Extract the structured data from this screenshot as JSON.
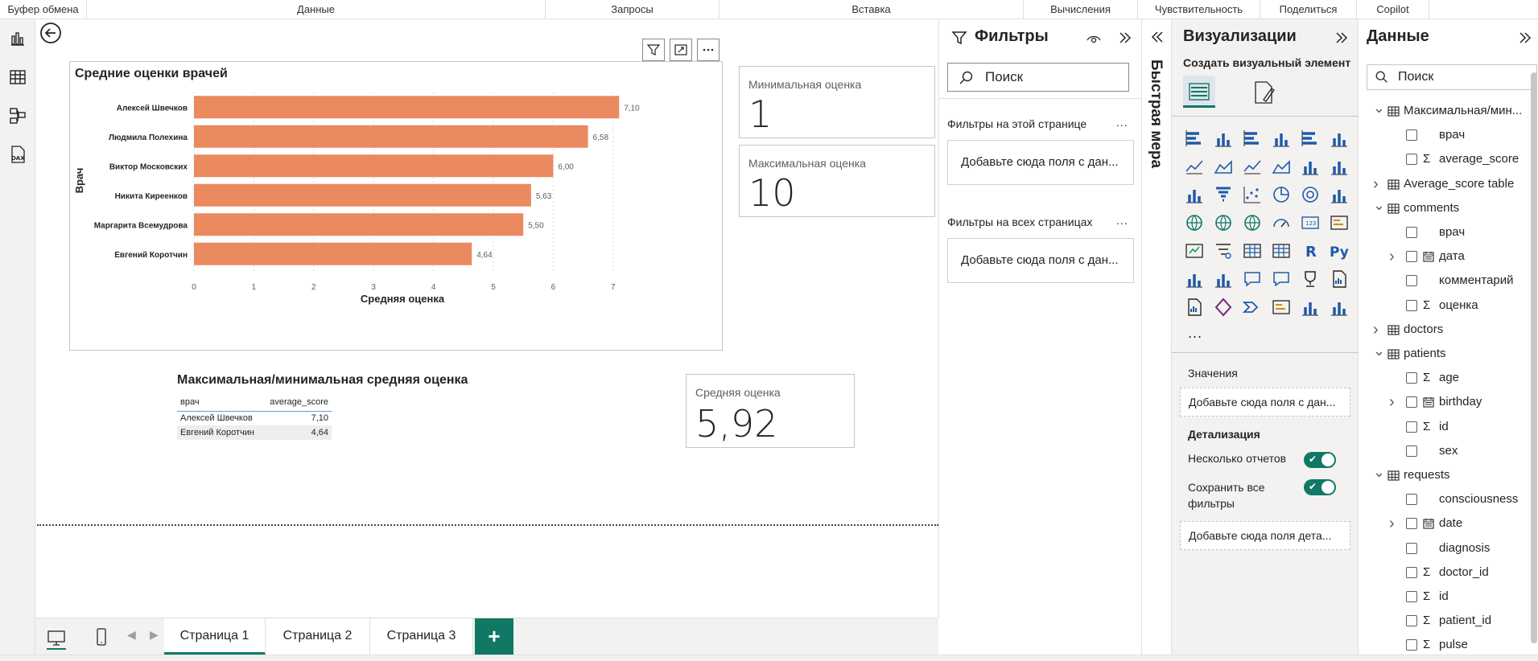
{
  "ribbon": {
    "groups": [
      "Буфер обмена",
      "Данные",
      "Запросы",
      "Вставка",
      "Вычисления",
      "Чувствительность",
      "Поделиться",
      "Copilot"
    ]
  },
  "chart_data": {
    "type": "bar",
    "title": "Средние оценки врачей",
    "xlabel": "Средняя оценка",
    "ylabel": "Врач",
    "categories": [
      "Алексей Швечков",
      "Людмила Полехина",
      "Виктор Московских",
      "Никита Киреенков",
      "Маргарита Всемудрова",
      "Евгений Коротчин"
    ],
    "values": [
      7.1,
      6.58,
      6.0,
      5.63,
      5.5,
      4.64
    ],
    "data_labels": [
      "7,10",
      "6,58",
      "6,00",
      "5,63",
      "5,50",
      "4,64"
    ],
    "xlim": [
      0,
      7.5
    ],
    "xticks": [
      "0",
      "1",
      "2",
      "3",
      "4",
      "5",
      "6",
      "7"
    ],
    "bar_color": "#EB895F",
    "grid": true
  },
  "cards": {
    "min_label": "Минимальная оценка",
    "min_value": "1",
    "max_label": "Максимальная оценка",
    "max_value": "10",
    "avg_label": "Средняя оценка",
    "avg_value": "5,92"
  },
  "table": {
    "title": "Максимальная/минимальная средняя оценка",
    "columns": [
      "врач",
      "average_score"
    ],
    "rows": [
      [
        "Алексей Швечков",
        "7,10"
      ],
      [
        "Евгений Коротчин",
        "4,64"
      ]
    ]
  },
  "pages": {
    "tabs": [
      "Страница 1",
      "Страница 2",
      "Страница 3"
    ],
    "add": "+"
  },
  "filters": {
    "title": "Фильтры",
    "search_placeholder": "Поиск",
    "this_page": "Фильтры на этой странице",
    "all_pages": "Фильтры на всех страницах",
    "well_text": "Добавьте сюда поля с дан...",
    "more": "..."
  },
  "quick_measure": {
    "label": "Быстрая мера"
  },
  "viz": {
    "title": "Визуализации",
    "build": "Создать визуальный элемент",
    "more": "...",
    "values_label": "Значения",
    "values_well": "Добавьте сюда поля с дан...",
    "drill_label": "Детализация",
    "cross_report": "Несколько отчетов",
    "keep_filters": "Сохранить все фильтры",
    "drill_well": "Добавьте сюда поля дета..."
  },
  "data": {
    "title": "Данные",
    "search_placeholder": "Поиск",
    "tree": [
      {
        "label": "Максимальная/мин...",
        "level": 0,
        "kind": "table-calc",
        "expanded": true
      },
      {
        "label": "врач",
        "level": 1,
        "kind": "field"
      },
      {
        "label": "average_score",
        "level": 1,
        "kind": "measure"
      },
      {
        "label": "Average_score table",
        "level": 0,
        "kind": "table-calc",
        "expanded": false
      },
      {
        "label": "comments",
        "level": 0,
        "kind": "table",
        "expanded": true
      },
      {
        "label": "врач",
        "level": 1,
        "kind": "field"
      },
      {
        "label": "дата",
        "level": 1,
        "kind": "date",
        "expandable": true
      },
      {
        "label": "комментарий",
        "level": 1,
        "kind": "field"
      },
      {
        "label": "оценка",
        "level": 1,
        "kind": "measure"
      },
      {
        "label": "doctors",
        "level": 0,
        "kind": "table",
        "expanded": false
      },
      {
        "label": "patients",
        "level": 0,
        "kind": "table",
        "expanded": true
      },
      {
        "label": "age",
        "level": 1,
        "kind": "measure"
      },
      {
        "label": "birthday",
        "level": 1,
        "kind": "date",
        "expandable": true
      },
      {
        "label": "id",
        "level": 1,
        "kind": "measure"
      },
      {
        "label": "sex",
        "level": 1,
        "kind": "field"
      },
      {
        "label": "requests",
        "level": 0,
        "kind": "table",
        "expanded": true
      },
      {
        "label": "consciousness",
        "level": 1,
        "kind": "field"
      },
      {
        "label": "date",
        "level": 1,
        "kind": "date",
        "expandable": true
      },
      {
        "label": "diagnosis",
        "level": 1,
        "kind": "field"
      },
      {
        "label": "doctor_id",
        "level": 1,
        "kind": "measure"
      },
      {
        "label": "id",
        "level": 1,
        "kind": "measure"
      },
      {
        "label": "patient_id",
        "level": 1,
        "kind": "measure"
      },
      {
        "label": "pulse",
        "level": 1,
        "kind": "measure"
      }
    ]
  },
  "colors": {
    "accent": "#117865",
    "bar": "#EB895F"
  }
}
